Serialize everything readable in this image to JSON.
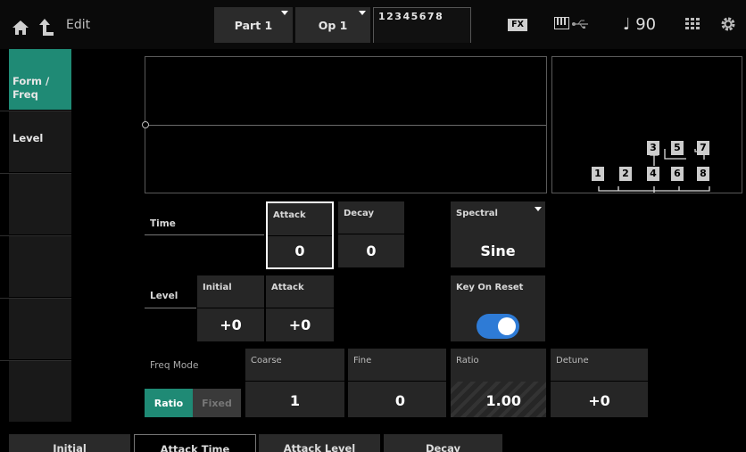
{
  "header": {
    "title": "Edit",
    "part_label": "Part 1",
    "op_label": "Op 1",
    "operators": "12345678",
    "fx_label": "FX",
    "tempo": "♩ 90"
  },
  "sidebar": {
    "items": [
      {
        "label": "Form /\nFreq",
        "active": true
      },
      {
        "label": "Level",
        "active": false
      }
    ]
  },
  "params": {
    "time_label": "Time",
    "time_attack": {
      "caption": "Attack",
      "value": "0"
    },
    "time_decay": {
      "caption": "Decay",
      "value": "0"
    },
    "level_label": "Level",
    "level_initial": {
      "caption": "Initial",
      "value": "+0"
    },
    "level_attack": {
      "caption": "Attack",
      "value": "+0"
    },
    "spectral": {
      "caption": "Spectral",
      "value": "Sine"
    },
    "key_on_reset": {
      "caption": "Key On Reset",
      "on": true
    },
    "freq_mode_label": "Freq Mode",
    "freq_mode_ratio": "Ratio",
    "freq_mode_fixed": "Fixed",
    "coarse": {
      "caption": "Coarse",
      "value": "1"
    },
    "fine": {
      "caption": "Fine",
      "value": "0"
    },
    "ratio": {
      "caption": "Ratio",
      "value": "1.00"
    },
    "detune": {
      "caption": "Detune",
      "value": "+0"
    }
  },
  "algorithm": {
    "top": [
      "3",
      "5",
      "7"
    ],
    "bottom": [
      "1",
      "2",
      "4",
      "6",
      "8"
    ]
  },
  "bottom_tabs": [
    "Initial",
    "Attack Time",
    "Attack Level",
    "Decay"
  ],
  "colors": {
    "accent": "#1f8a75",
    "toggle": "#2e7bd6"
  }
}
